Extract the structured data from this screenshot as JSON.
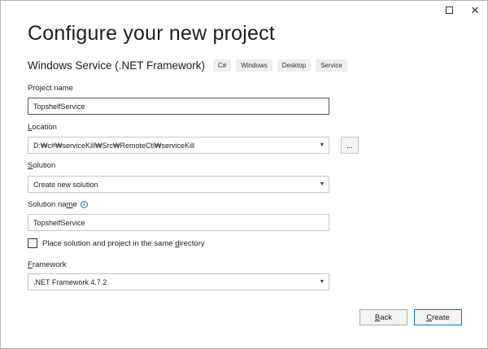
{
  "window": {
    "maximize_icon": "maximize-icon",
    "close_icon": "close-icon",
    "close_glyph": "✕"
  },
  "header": {
    "title": "Configure your new project",
    "template_name": "Windows Service (.NET Framework)",
    "tags": [
      "C#",
      "Windows",
      "Desktop",
      "Service"
    ]
  },
  "form": {
    "project_name": {
      "label": "Project name",
      "value": "TopshelfService"
    },
    "location": {
      "label_ul": "L",
      "label_rest": "ocation",
      "value": "D:₩c#₩serviceKill₩Src₩RemoteCtl₩serviceKill",
      "browse_label": "..."
    },
    "solution": {
      "label_ul": "S",
      "label_rest": "olution",
      "value": "Create new solution"
    },
    "solution_name": {
      "label_pre": "Solution na",
      "label_ul": "m",
      "label_post": "e",
      "info_icon": "info-icon",
      "value": "TopshelfService"
    },
    "same_directory": {
      "checked": false,
      "label_pre": "Place solution and project in the same ",
      "label_ul": "d",
      "label_post": "irectory"
    },
    "framework": {
      "label_ul": "F",
      "label_rest": "ramework",
      "value": ".NET Framework 4.7.2"
    }
  },
  "footer": {
    "back_ul": "B",
    "back_rest": "ack",
    "create_ul": "C",
    "create_rest": "reate"
  },
  "colors": {
    "accent": "#0078d7",
    "info": "#1f6fc1",
    "tag_bg": "#eeeef0"
  }
}
